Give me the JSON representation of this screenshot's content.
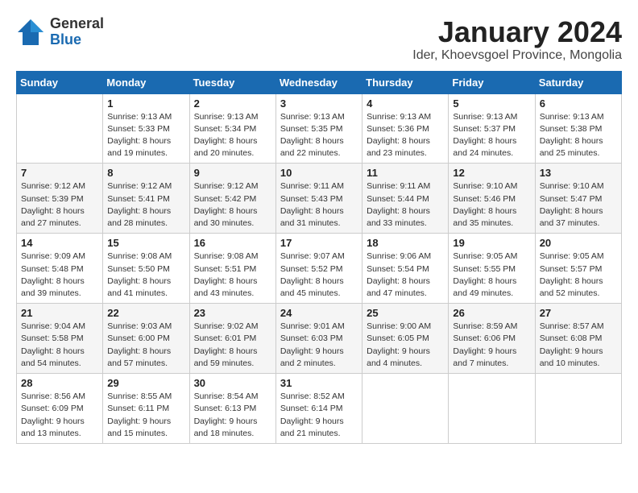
{
  "logo": {
    "general": "General",
    "blue": "Blue"
  },
  "title": "January 2024",
  "location": "Ider, Khoevsgoel Province, Mongolia",
  "days_of_week": [
    "Sunday",
    "Monday",
    "Tuesday",
    "Wednesday",
    "Thursday",
    "Friday",
    "Saturday"
  ],
  "weeks": [
    [
      {
        "day": "",
        "info": ""
      },
      {
        "day": "1",
        "info": "Sunrise: 9:13 AM\nSunset: 5:33 PM\nDaylight: 8 hours\nand 19 minutes."
      },
      {
        "day": "2",
        "info": "Sunrise: 9:13 AM\nSunset: 5:34 PM\nDaylight: 8 hours\nand 20 minutes."
      },
      {
        "day": "3",
        "info": "Sunrise: 9:13 AM\nSunset: 5:35 PM\nDaylight: 8 hours\nand 22 minutes."
      },
      {
        "day": "4",
        "info": "Sunrise: 9:13 AM\nSunset: 5:36 PM\nDaylight: 8 hours\nand 23 minutes."
      },
      {
        "day": "5",
        "info": "Sunrise: 9:13 AM\nSunset: 5:37 PM\nDaylight: 8 hours\nand 24 minutes."
      },
      {
        "day": "6",
        "info": "Sunrise: 9:13 AM\nSunset: 5:38 PM\nDaylight: 8 hours\nand 25 minutes."
      }
    ],
    [
      {
        "day": "7",
        "info": "Sunrise: 9:12 AM\nSunset: 5:39 PM\nDaylight: 8 hours\nand 27 minutes."
      },
      {
        "day": "8",
        "info": "Sunrise: 9:12 AM\nSunset: 5:41 PM\nDaylight: 8 hours\nand 28 minutes."
      },
      {
        "day": "9",
        "info": "Sunrise: 9:12 AM\nSunset: 5:42 PM\nDaylight: 8 hours\nand 30 minutes."
      },
      {
        "day": "10",
        "info": "Sunrise: 9:11 AM\nSunset: 5:43 PM\nDaylight: 8 hours\nand 31 minutes."
      },
      {
        "day": "11",
        "info": "Sunrise: 9:11 AM\nSunset: 5:44 PM\nDaylight: 8 hours\nand 33 minutes."
      },
      {
        "day": "12",
        "info": "Sunrise: 9:10 AM\nSunset: 5:46 PM\nDaylight: 8 hours\nand 35 minutes."
      },
      {
        "day": "13",
        "info": "Sunrise: 9:10 AM\nSunset: 5:47 PM\nDaylight: 8 hours\nand 37 minutes."
      }
    ],
    [
      {
        "day": "14",
        "info": "Sunrise: 9:09 AM\nSunset: 5:48 PM\nDaylight: 8 hours\nand 39 minutes."
      },
      {
        "day": "15",
        "info": "Sunrise: 9:08 AM\nSunset: 5:50 PM\nDaylight: 8 hours\nand 41 minutes."
      },
      {
        "day": "16",
        "info": "Sunrise: 9:08 AM\nSunset: 5:51 PM\nDaylight: 8 hours\nand 43 minutes."
      },
      {
        "day": "17",
        "info": "Sunrise: 9:07 AM\nSunset: 5:52 PM\nDaylight: 8 hours\nand 45 minutes."
      },
      {
        "day": "18",
        "info": "Sunrise: 9:06 AM\nSunset: 5:54 PM\nDaylight: 8 hours\nand 47 minutes."
      },
      {
        "day": "19",
        "info": "Sunrise: 9:05 AM\nSunset: 5:55 PM\nDaylight: 8 hours\nand 49 minutes."
      },
      {
        "day": "20",
        "info": "Sunrise: 9:05 AM\nSunset: 5:57 PM\nDaylight: 8 hours\nand 52 minutes."
      }
    ],
    [
      {
        "day": "21",
        "info": "Sunrise: 9:04 AM\nSunset: 5:58 PM\nDaylight: 8 hours\nand 54 minutes."
      },
      {
        "day": "22",
        "info": "Sunrise: 9:03 AM\nSunset: 6:00 PM\nDaylight: 8 hours\nand 57 minutes."
      },
      {
        "day": "23",
        "info": "Sunrise: 9:02 AM\nSunset: 6:01 PM\nDaylight: 8 hours\nand 59 minutes."
      },
      {
        "day": "24",
        "info": "Sunrise: 9:01 AM\nSunset: 6:03 PM\nDaylight: 9 hours\nand 2 minutes."
      },
      {
        "day": "25",
        "info": "Sunrise: 9:00 AM\nSunset: 6:05 PM\nDaylight: 9 hours\nand 4 minutes."
      },
      {
        "day": "26",
        "info": "Sunrise: 8:59 AM\nSunset: 6:06 PM\nDaylight: 9 hours\nand 7 minutes."
      },
      {
        "day": "27",
        "info": "Sunrise: 8:57 AM\nSunset: 6:08 PM\nDaylight: 9 hours\nand 10 minutes."
      }
    ],
    [
      {
        "day": "28",
        "info": "Sunrise: 8:56 AM\nSunset: 6:09 PM\nDaylight: 9 hours\nand 13 minutes."
      },
      {
        "day": "29",
        "info": "Sunrise: 8:55 AM\nSunset: 6:11 PM\nDaylight: 9 hours\nand 15 minutes."
      },
      {
        "day": "30",
        "info": "Sunrise: 8:54 AM\nSunset: 6:13 PM\nDaylight: 9 hours\nand 18 minutes."
      },
      {
        "day": "31",
        "info": "Sunrise: 8:52 AM\nSunset: 6:14 PM\nDaylight: 9 hours\nand 21 minutes."
      },
      {
        "day": "",
        "info": ""
      },
      {
        "day": "",
        "info": ""
      },
      {
        "day": "",
        "info": ""
      }
    ]
  ]
}
